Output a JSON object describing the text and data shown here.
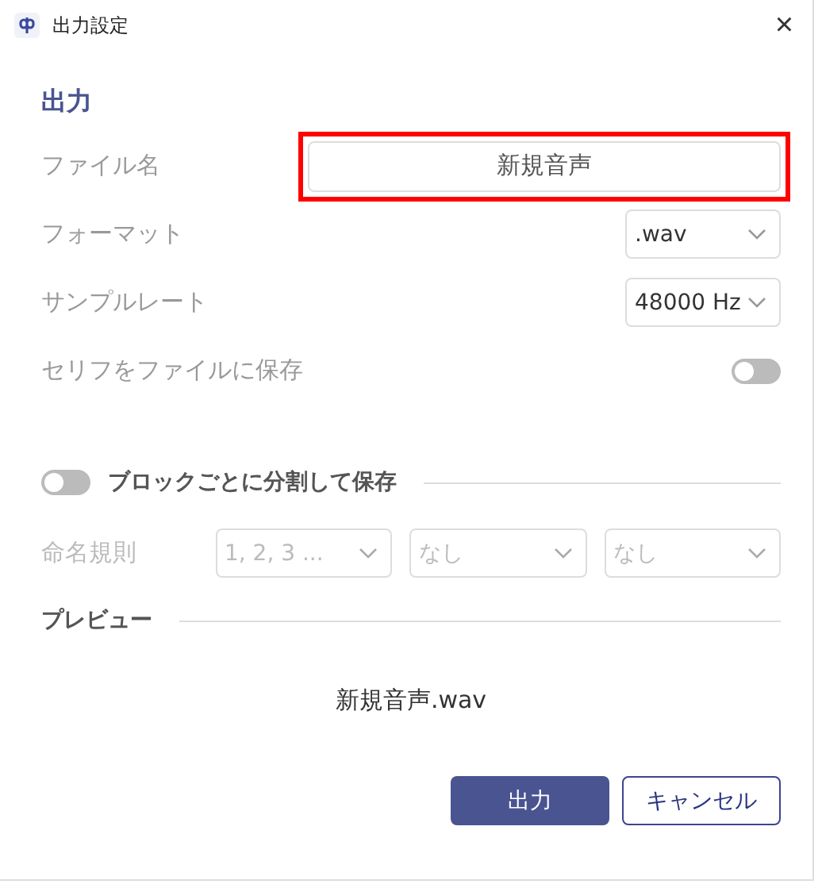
{
  "window": {
    "title": "出力設定",
    "close": "×"
  },
  "section_title": "出力",
  "fields": [
    {
      "kind": "text",
      "label": "ファイル名",
      "value": "新規音声",
      "highlighted": true
    },
    {
      "kind": "select",
      "label": "フォーマット",
      "value": ".wav"
    },
    {
      "kind": "select",
      "label": "サンプルレート",
      "value": "48000 Hz"
    },
    {
      "kind": "toggle",
      "label": "セリフをファイルに保存",
      "on": false
    }
  ],
  "split": {
    "label": "ブロックごとに分割して保存",
    "on": false
  },
  "naming": {
    "label": "命名規則",
    "disabled": true,
    "options": [
      "1, 2, 3 ...",
      "なし",
      "なし"
    ]
  },
  "preview": {
    "title": "プレビュー",
    "text": "新規音声.wav"
  },
  "buttons": [
    {
      "label": "出力",
      "kind": "primary"
    },
    {
      "label": "キャンセル",
      "kind": "secondary"
    }
  ]
}
